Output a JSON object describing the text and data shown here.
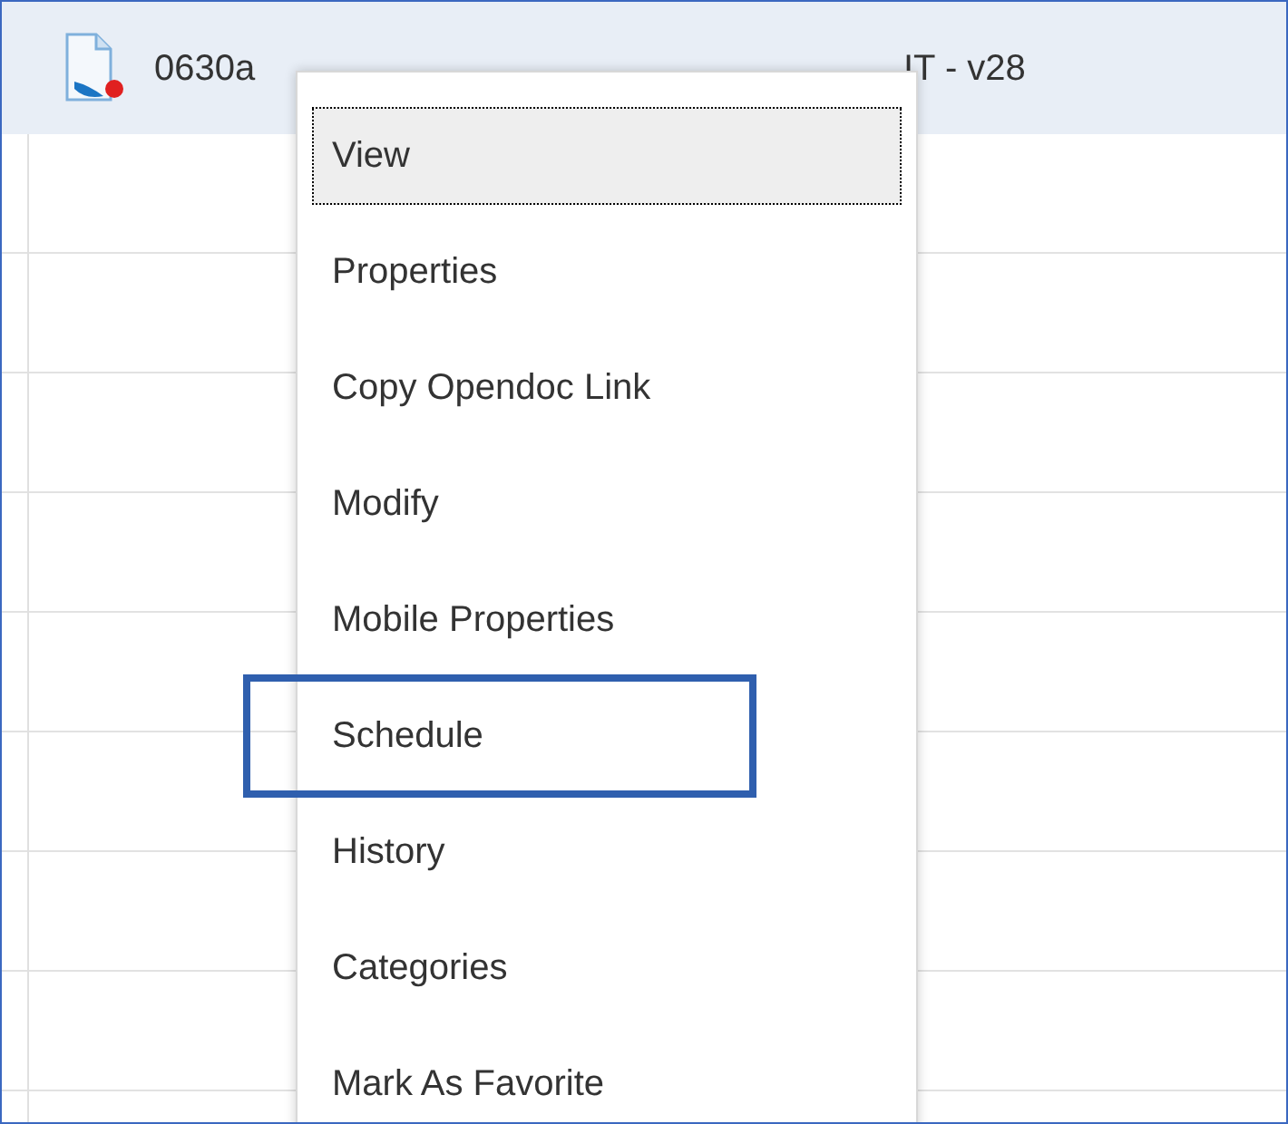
{
  "document_row": {
    "title_start": "0630a",
    "title_end": "IT - v28"
  },
  "context_menu": {
    "items": [
      {
        "label": "View",
        "selected": true,
        "highlighted": false
      },
      {
        "label": "Properties",
        "selected": false,
        "highlighted": false
      },
      {
        "label": "Copy Opendoc Link",
        "selected": false,
        "highlighted": false
      },
      {
        "label": "Modify",
        "selected": false,
        "highlighted": false
      },
      {
        "label": "Mobile Properties",
        "selected": false,
        "highlighted": false
      },
      {
        "label": "Schedule",
        "selected": false,
        "highlighted": true
      },
      {
        "label": "History",
        "selected": false,
        "highlighted": false
      },
      {
        "label": "Categories",
        "selected": false,
        "highlighted": false
      },
      {
        "label": "Mark As Favorite",
        "selected": false,
        "highlighted": false
      }
    ]
  }
}
